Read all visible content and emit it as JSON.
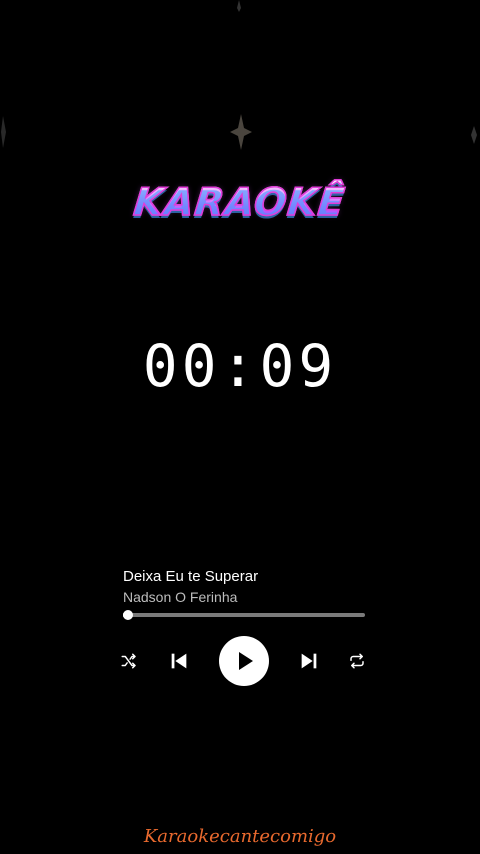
{
  "logo": {
    "text": "KARAOKÊ"
  },
  "timer": {
    "display": "00:09"
  },
  "song": {
    "title": "Deixa Eu te Superar",
    "artist": "Nadson O Ferinha"
  },
  "player": {
    "progress": 0.01,
    "icons": {
      "shuffle": "shuffle-icon",
      "previous": "skip-previous-icon",
      "play": "play-icon",
      "next": "skip-next-icon",
      "repeat": "repeat-icon"
    }
  },
  "watermark": {
    "text": "Karaokecantecomigo"
  },
  "colors": {
    "background": "#000000",
    "logo_gradient_top": "#ffffff",
    "logo_gradient_bottom": "#7d3cff",
    "logo_outline": "#e23bd8",
    "watermark": "#e8692e",
    "track": "#7a7a7a",
    "artist_text": "#bdbdbd"
  }
}
